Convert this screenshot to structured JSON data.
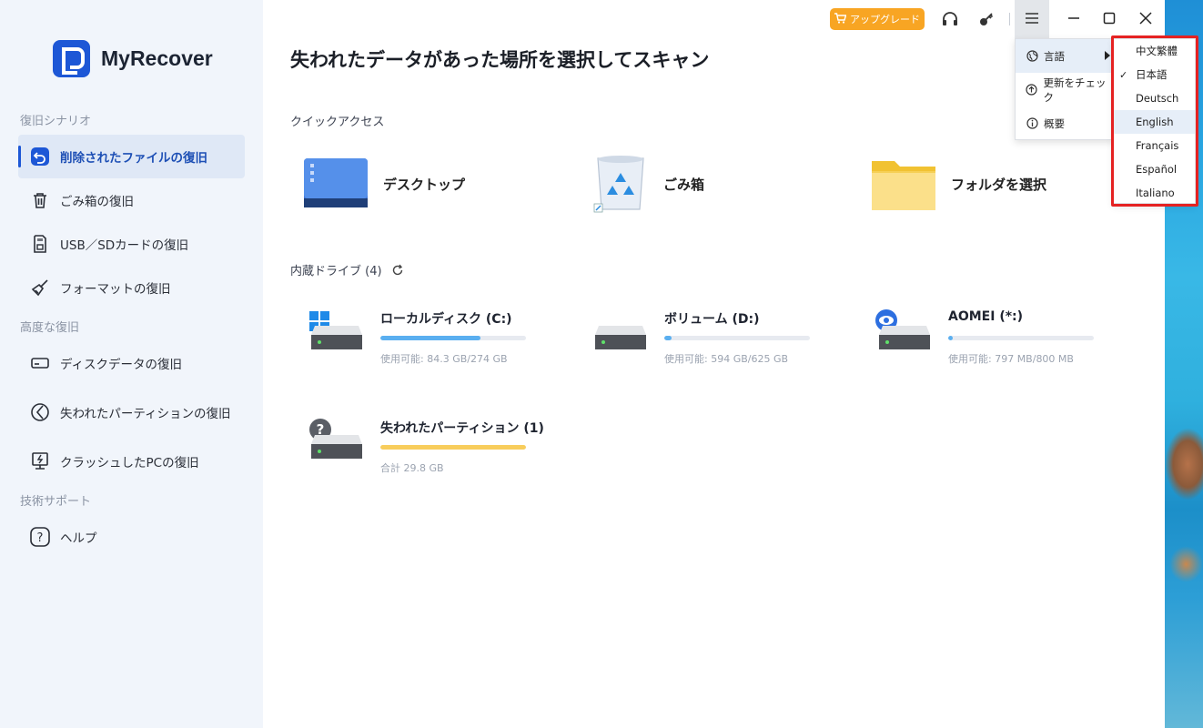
{
  "app": {
    "name": "MyRecover"
  },
  "sidebar": {
    "sections": [
      {
        "label": "復旧シナリオ"
      },
      {
        "label": "高度な復旧"
      },
      {
        "label": "技術サポート"
      }
    ],
    "items": [
      {
        "label": "削除されたファイルの復旧",
        "icon": "undo-icon",
        "active": true
      },
      {
        "label": "ごみ箱の復旧",
        "icon": "trash-icon"
      },
      {
        "label": "USB／SDカードの復旧",
        "icon": "sd-card-icon"
      },
      {
        "label": "フォーマットの復旧",
        "icon": "broom-icon"
      },
      {
        "label": "ディスクデータの復旧",
        "icon": "disk-icon"
      },
      {
        "label": "失われたパーティションの復旧",
        "icon": "partition-icon"
      },
      {
        "label": "クラッシュしたPCの復旧",
        "icon": "crashed-pc-icon"
      },
      {
        "label": "ヘルプ",
        "icon": "help-icon"
      }
    ]
  },
  "main": {
    "title": "失われたデータがあった場所を選択してスキャン",
    "quick_access": {
      "label": "クイックアクセス",
      "items": [
        {
          "label": "デスクトップ",
          "icon": "desktop-icon"
        },
        {
          "label": "ごみ箱",
          "icon": "recycle-bin-icon"
        },
        {
          "label": "フォルダを選択",
          "icon": "folder-icon"
        }
      ]
    },
    "drives": {
      "label": "内蔵ドライブ (4)",
      "items": [
        {
          "name": "ローカルディスク (C:)",
          "info": "使用可能: 84.3 GB/274 GB",
          "used_fraction": 0.69,
          "bar_color": "#5aaff0",
          "badge": "windows"
        },
        {
          "name": "ボリューム (D:)",
          "info": "使用可能: 594 GB/625 GB",
          "used_fraction": 0.05,
          "bar_color": "#5aaff0",
          "badge": "none"
        },
        {
          "name": "AOMEI (*:)",
          "info": "使用可能: 797 MB/800 MB",
          "used_fraction": 0.004,
          "bar_color": "#5aaff0",
          "badge": "eye"
        },
        {
          "name": "失われたパーティション (1)",
          "info": "合計 29.8 GB",
          "used_fraction": 1.0,
          "bar_color": "#f8cd5c",
          "badge": "question"
        }
      ]
    }
  },
  "toolbar": {
    "upgrade_label": "アップグレード",
    "upgrade_color": "#f8a523"
  },
  "main_menu": {
    "items": [
      {
        "label": "言語",
        "icon": "globe-icon",
        "has_submenu": true
      },
      {
        "label": "更新をチェック",
        "icon": "update-icon"
      },
      {
        "label": "概要",
        "icon": "info-icon"
      }
    ]
  },
  "language_menu": {
    "items": [
      {
        "label": "中文繁體"
      },
      {
        "label": "日本語",
        "checked": true
      },
      {
        "label": "Deutsch"
      },
      {
        "label": "English",
        "hover": true
      },
      {
        "label": "Français"
      },
      {
        "label": "Español"
      },
      {
        "label": "Italiano"
      }
    ],
    "check_mark": "✓"
  },
  "colors": {
    "accent": "#1d57d6",
    "highlight": "#e52222"
  }
}
